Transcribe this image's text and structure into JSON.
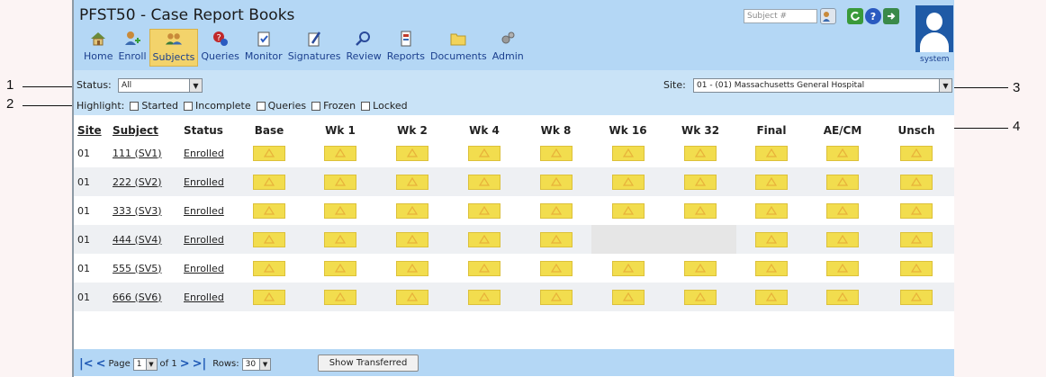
{
  "app": {
    "title": "PFST50 - Case Report Books",
    "user": "system",
    "subject_search_placeholder": "Subject #"
  },
  "nav": [
    {
      "label": "Home",
      "icon": "home-icon"
    },
    {
      "label": "Enroll",
      "icon": "enroll-icon"
    },
    {
      "label": "Subjects",
      "icon": "subjects-icon",
      "active": true
    },
    {
      "label": "Queries",
      "icon": "queries-icon"
    },
    {
      "label": "Monitor",
      "icon": "monitor-icon"
    },
    {
      "label": "Signatures",
      "icon": "signatures-icon"
    },
    {
      "label": "Review",
      "icon": "review-icon"
    },
    {
      "label": "Reports",
      "icon": "reports-icon"
    },
    {
      "label": "Documents",
      "icon": "documents-icon"
    },
    {
      "label": "Admin",
      "icon": "admin-icon"
    }
  ],
  "filters": {
    "status_label": "Status:",
    "status_value": "All",
    "highlight_label": "Highlight:",
    "highlight_options": [
      "Started",
      "Incomplete",
      "Queries",
      "Frozen",
      "Locked"
    ],
    "site_label": "Site:",
    "site_value": "01 - (01) Massachusetts General Hospital"
  },
  "callouts": [
    "1",
    "2",
    "3",
    "4"
  ],
  "table": {
    "columns": [
      "Site",
      "Subject",
      "Status",
      "Base",
      "Wk 1",
      "Wk 2",
      "Wk 4",
      "Wk 8",
      "Wk 16",
      "Wk 32",
      "Final",
      "AE/CM",
      "Unsch"
    ],
    "rows": [
      {
        "site": "01",
        "subject": "111 (SV1)",
        "status": "Enrolled",
        "visits": [
          true,
          true,
          true,
          true,
          true,
          true,
          true,
          true,
          true,
          true
        ]
      },
      {
        "site": "01",
        "subject": "222 (SV2)",
        "status": "Enrolled",
        "visits": [
          true,
          true,
          true,
          true,
          true,
          true,
          true,
          true,
          true,
          true
        ]
      },
      {
        "site": "01",
        "subject": "333 (SV3)",
        "status": "Enrolled",
        "visits": [
          true,
          true,
          true,
          true,
          true,
          true,
          true,
          true,
          true,
          true
        ]
      },
      {
        "site": "01",
        "subject": "444 (SV4)",
        "status": "Enrolled",
        "visits": [
          true,
          true,
          true,
          true,
          true,
          false,
          false,
          true,
          true,
          true
        ]
      },
      {
        "site": "01",
        "subject": "555 (SV5)",
        "status": "Enrolled",
        "visits": [
          true,
          true,
          true,
          true,
          true,
          true,
          true,
          true,
          true,
          true
        ]
      },
      {
        "site": "01",
        "subject": "666 (SV6)",
        "status": "Enrolled",
        "visits": [
          true,
          true,
          true,
          true,
          true,
          true,
          true,
          true,
          true,
          true
        ]
      }
    ]
  },
  "footer": {
    "page_label": "Page",
    "page_value": "1",
    "of_label": "of 1",
    "rows_label": "Rows:",
    "rows_value": "30",
    "show_transferred": "Show Transferred"
  },
  "colors": {
    "header_bg": "#b4d7f5",
    "filter_bg": "#c9e3f7",
    "visit_button": "#f2dd4e",
    "active_nav": "#f3d36b",
    "link_blue": "#1b3f8e"
  }
}
